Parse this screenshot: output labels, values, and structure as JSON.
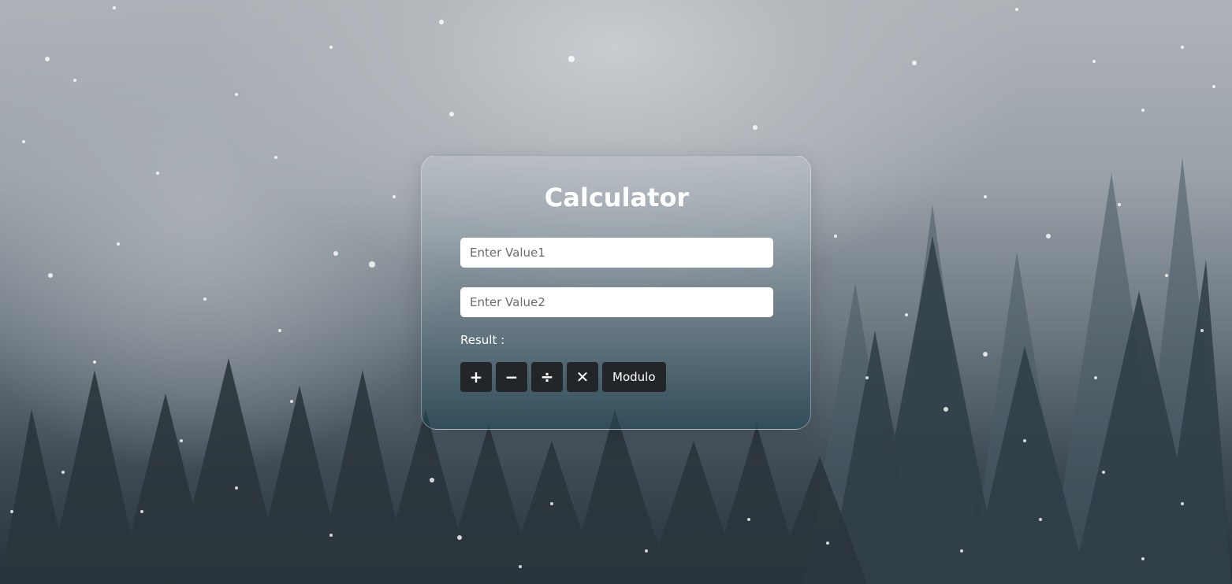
{
  "calculator": {
    "title": "Calculator",
    "value1_placeholder": "Enter Value1",
    "value2_placeholder": "Enter Value2",
    "value1": "",
    "value2": "",
    "result_label": "Result :",
    "result_value": ""
  },
  "operations": {
    "add_label": "+",
    "subtract_label": "−",
    "divide_label": "÷",
    "multiply_label": "✕",
    "modulo_label": "Modulo"
  },
  "colors": {
    "button_background": "#232629",
    "text": "#ffffff"
  }
}
